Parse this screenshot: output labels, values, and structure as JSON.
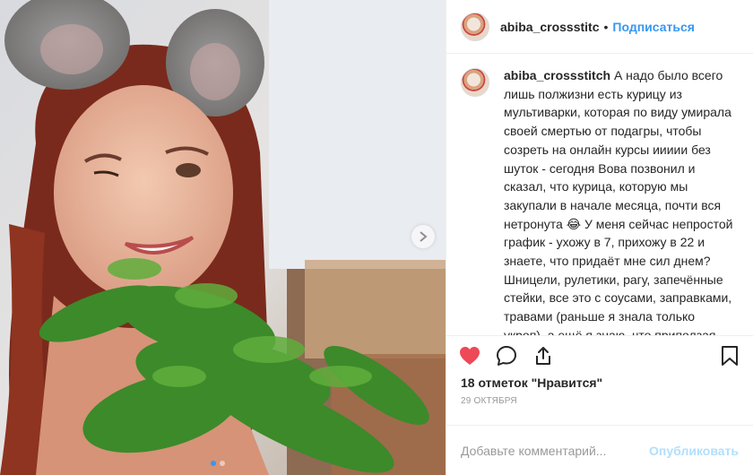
{
  "post": {
    "username": "abiba_crossstitc",
    "separator": "•",
    "follow_label": "Подписаться",
    "caption_username": "abiba_crossstitch",
    "caption_text": "А надо было всего лишь полжизни есть курицу из мультиварки, которая по виду умирала своей смертью от подагры, чтобы созреть на онлайн курсы иииии без шуток - сегодня Вова позвонил и сказал, что курица, которую мы закупали в начале месяца, почти вся нетронута 😂 У меня сейчас непростой график - ухожу в 7, прихожу в 22 и знаете, что придаёт мне сил днем? Шницели, рулетики, рагу, запечённые стейки, все это с соусами, заправками, травами (раньше я знала только укроп), а ещё я знаю, что приползая вечером я потрачу максимум час, чтобы на следующий день меня уже ждала... Утка с вишневым соусом и салатом из свёклы и сыра😌😌😌",
    "likes_text": "18 отметок \"Нравится\"",
    "date_text": "29 октября",
    "comment_placeholder": "Добавьте комментарий...",
    "publish_label": "Опубликовать"
  },
  "media": {
    "carousel_dots": 2,
    "active_dot": 0
  },
  "icons": {
    "like": "heart-icon",
    "comment": "speech-bubble-icon",
    "share": "share-icon",
    "save": "bookmark-icon",
    "next": "chevron-right-icon"
  },
  "colors": {
    "like_red": "#ed4956",
    "link_blue": "#3897f0",
    "publish_disabled": "#b2dffc",
    "muted_gray": "#999999"
  }
}
